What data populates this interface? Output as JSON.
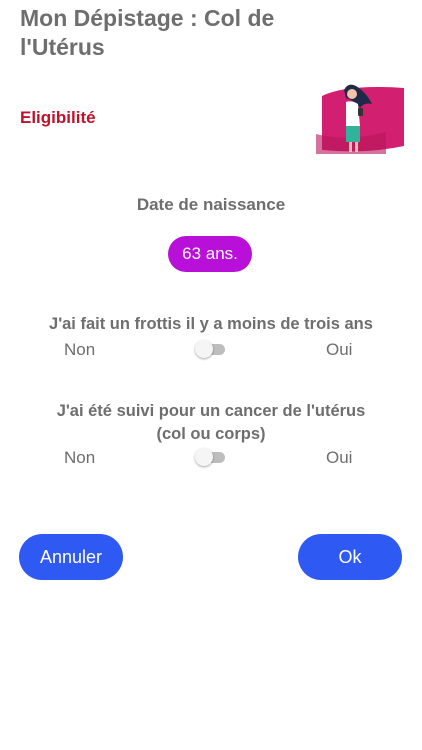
{
  "header": {
    "title": "Mon Dépistage : Col de l'Utérus"
  },
  "section": {
    "label": "Eligibilité"
  },
  "birth": {
    "label": "Date de naissance",
    "age_value": "63 ans."
  },
  "questions": [
    {
      "text": "J'ai fait un frottis il y a moins de trois ans",
      "no_label": "Non",
      "yes_label": "Oui",
      "value": false
    },
    {
      "text": "J'ai été suivi pour un cancer de l'utérus (col ou corps)",
      "no_label": "Non",
      "yes_label": "Oui",
      "value": false
    }
  ],
  "actions": {
    "cancel_label": "Annuler",
    "ok_label": "Ok"
  },
  "colors": {
    "accent": "#2e59f2",
    "age_pill": "#b80fd9",
    "section": "#c0102a"
  },
  "icons": {
    "illustration": "woman-with-phone-illustration"
  }
}
